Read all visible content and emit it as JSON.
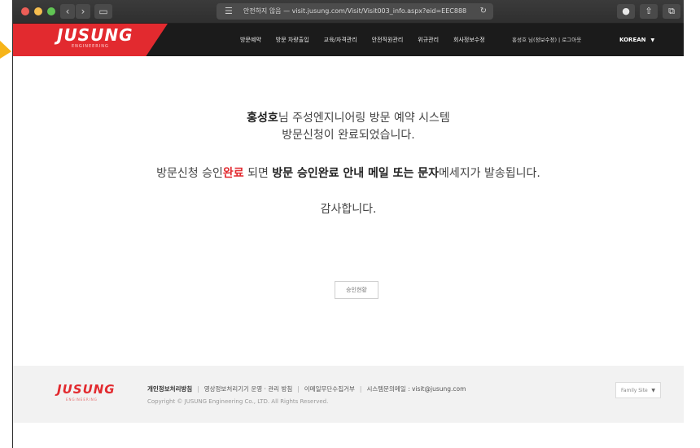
{
  "browser": {
    "address_text": "안전하지 않음 — visit.jusung.com/Visit/Visit003_info.aspx?eid=EEC888",
    "back_glyph": "‹",
    "forward_glyph": "›",
    "sidebar_glyph": "▭",
    "menu_glyph": "☰",
    "reload_glyph": "↻",
    "right_glyph_1": "●",
    "right_glyph_2": "⇧",
    "right_glyph_3": "⧉",
    "plus_glyph": "+"
  },
  "header": {
    "logo": "JUSUNG",
    "logo_sub": "ENGINEERING",
    "menu": [
      "방문예약",
      "방문 차량출입",
      "교육/자격관리",
      "안전직원관리",
      "위규관리",
      "회사정보수정"
    ],
    "user_links": "홍성호 님(정보수정) | 로그아웃",
    "language": "KOREAN",
    "language_caret": "▼"
  },
  "message": {
    "name": "홍성호",
    "line1_rest": "님 주성엔지니어링 방문 예약 시스템",
    "line2": "방문신청이 완료되었습니다.",
    "line3_part1": "방문신청 승인",
    "line3_red": "완료",
    "line3_part2": " 되면 ",
    "line3_bold": "방문 승인완료 안내 메일 또는 문자",
    "line3_part3": "메세지가 발송됩니다.",
    "line4": "감사합니다."
  },
  "actions": {
    "approval_status_label": "승인현황"
  },
  "footer": {
    "logo": "JUSUNG",
    "logo_sub": "ENGINEERING",
    "links": [
      "개인정보처리방침",
      "영상정보처리기기 운영 · 관리 방침",
      "이메일무단수집거부",
      "시스템문의메일 : visit@jusung.com"
    ],
    "separator": "|",
    "copyright": "Copyright © JUSUNG Engineering Co., LTD. All Rights Reserved.",
    "family_site": "Family Site",
    "family_caret": "▼"
  },
  "colors": {
    "brand_red": "#e22a2f",
    "header_bg": "#1b1b1b",
    "footer_bg": "#f2f2f2"
  }
}
